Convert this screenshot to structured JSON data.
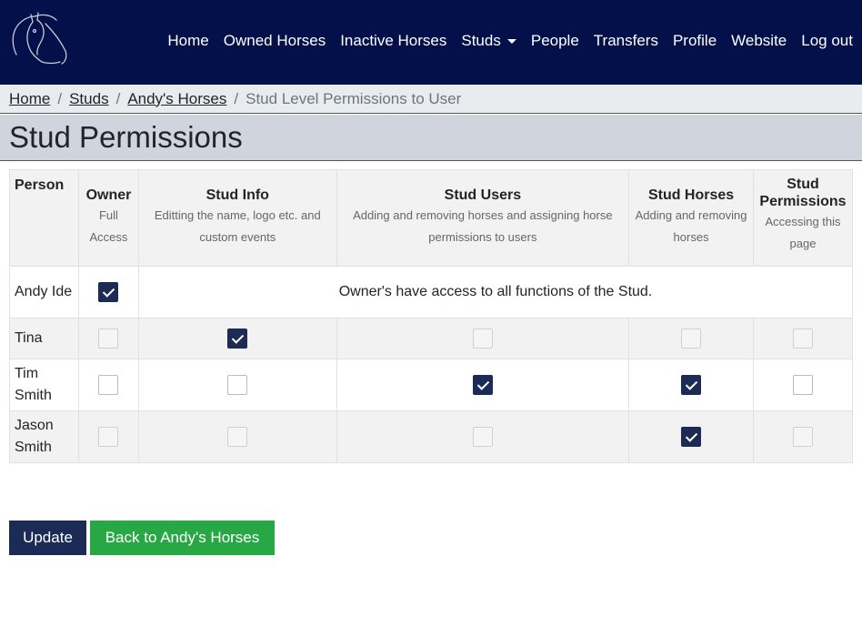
{
  "nav": {
    "links": [
      "Home",
      "Owned Horses",
      "Inactive Horses",
      "Studs",
      "People",
      "Transfers",
      "Profile",
      "Website",
      "Log out"
    ],
    "dropdown_index": 3,
    "logo_icon": "horse-head-icon"
  },
  "breadcrumb": {
    "items": [
      "Home",
      "Studs",
      "Andy's Horses"
    ],
    "active": "Stud Level Permissions to User"
  },
  "page": {
    "title": "Stud Permissions"
  },
  "table": {
    "headers": {
      "person": "Person",
      "owner": {
        "title": "Owner",
        "sub": "Full Access"
      },
      "stud_info": {
        "title": "Stud Info",
        "sub": "Editting the name, logo etc. and custom events"
      },
      "stud_users": {
        "title": "Stud Users",
        "sub": "Adding and removing horses and assigning horse permissions to users"
      },
      "stud_horses": {
        "title": "Stud Horses",
        "sub": "Adding and removing horses"
      },
      "stud_permissions": {
        "title": "Stud Permissions",
        "sub": "Accessing this page"
      }
    },
    "owner_note": "Owner's have access to all functions of the Stud.",
    "rows": [
      {
        "name": "Andy Ide",
        "owner": true
      },
      {
        "name": "Tina",
        "owner": false,
        "stud_info": true,
        "stud_users": false,
        "stud_horses": false,
        "stud_permissions": false
      },
      {
        "name": "Tim Smith",
        "owner": false,
        "stud_info": false,
        "stud_users": true,
        "stud_horses": true,
        "stud_permissions": false
      },
      {
        "name": "Jason Smith",
        "owner": false,
        "stud_info": false,
        "stud_users": false,
        "stud_horses": true,
        "stud_permissions": false
      }
    ]
  },
  "buttons": {
    "update": "Update",
    "back": "Back to Andy's Horses"
  },
  "colors": {
    "navbar": "#03104a",
    "primary": "#1c2a56",
    "success": "#28a745",
    "title_bar": "#cfd4dd",
    "breadcrumb_bg": "#e9ecef"
  }
}
